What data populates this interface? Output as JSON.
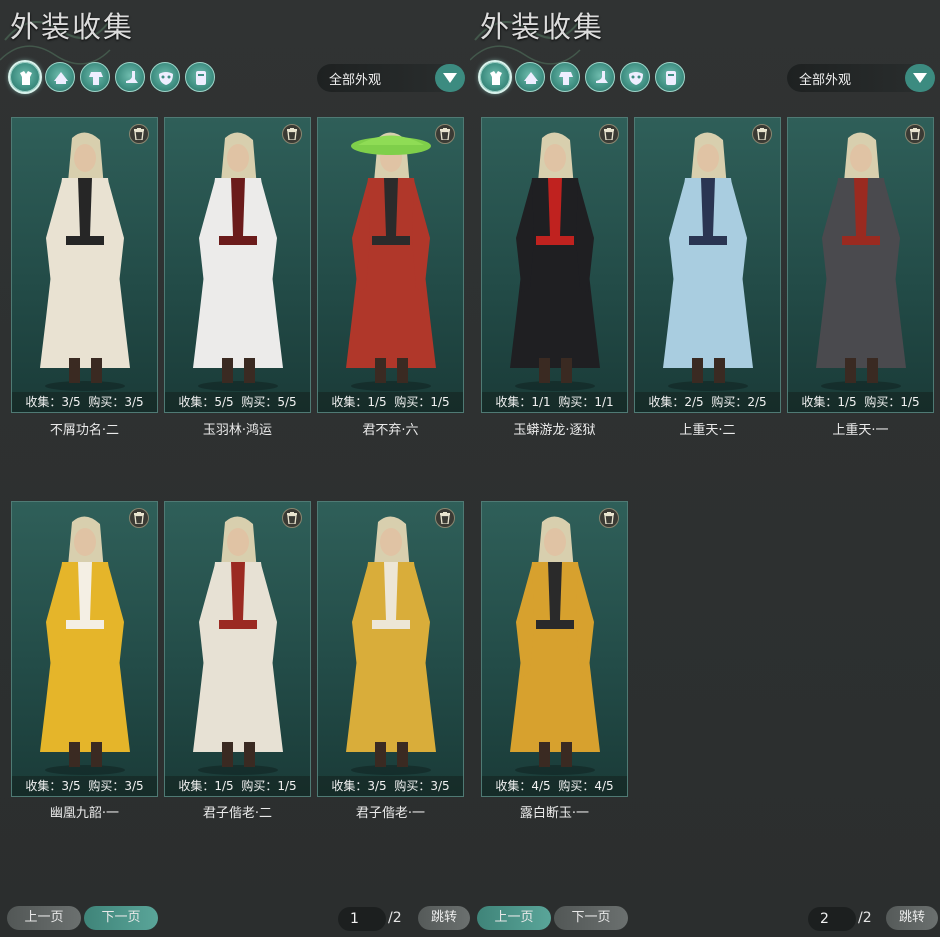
{
  "panels": [
    {
      "title": "外装收集",
      "filter": "全部外观",
      "cards": [
        {
          "name": "不屑功名·二",
          "collect": "收集：3/5",
          "buy": "购买：3/5",
          "outfit": "#e9e2d2",
          "accent": "#262626",
          "hat": false
        },
        {
          "name": "玉羽林·鸿运",
          "collect": "收集：5/5",
          "buy": "购买：5/5",
          "outfit": "#ecebea",
          "accent": "#6b1b1b",
          "hat": false
        },
        {
          "name": "君不弃·六",
          "collect": "收集：1/5",
          "buy": "购买：1/5",
          "outfit": "#b0372a",
          "accent": "#2b2b2b",
          "hat": true
        },
        {
          "name": "幽凰九韶·一",
          "collect": "收集：3/5",
          "buy": "购买：3/5",
          "outfit": "#e5b52a",
          "accent": "#f4efe4",
          "hat": false
        },
        {
          "name": "君子偕老·二",
          "collect": "收集：1/5",
          "buy": "购买：1/5",
          "outfit": "#e7e1d4",
          "accent": "#9b2a22",
          "hat": false
        },
        {
          "name": "君子偕老·一",
          "collect": "收集：3/5",
          "buy": "购买：3/5",
          "outfit": "#d9ad3a",
          "accent": "#ede6d6",
          "hat": false
        }
      ],
      "pager": {
        "prev": "上一页",
        "next": "下一页",
        "page": "1",
        "total": "/2",
        "jump": "跳转"
      }
    },
    {
      "title": "外装收集",
      "filter": "全部外观",
      "cards": [
        {
          "name": "玉蟒游龙·逐狱",
          "collect": "收集：1/1",
          "buy": "购买：1/1",
          "outfit": "#1f1f22",
          "accent": "#c0221f",
          "hat": false
        },
        {
          "name": "上重天·二",
          "collect": "收集：2/5",
          "buy": "购买：2/5",
          "outfit": "#a9cde0",
          "accent": "#2a3552",
          "hat": false
        },
        {
          "name": "上重天·一",
          "collect": "收集：1/5",
          "buy": "购买：1/5",
          "outfit": "#4a4a4e",
          "accent": "#9a2a20",
          "hat": false
        },
        {
          "name": "露白断玉·一",
          "collect": "收集：4/5",
          "buy": "购买：4/5",
          "outfit": "#d7a12e",
          "accent": "#2a2a2a",
          "hat": false
        }
      ],
      "pager": {
        "prev": "上一页",
        "next": "下一页",
        "page": "2",
        "total": "/2",
        "jump": "跳转"
      }
    }
  ],
  "colors": {
    "accent": "#3c8b80",
    "card_bg": "#2a5852",
    "panel_bg": "#2e3131"
  },
  "icons": [
    "outfit-all-icon",
    "headwear-icon",
    "top-icon",
    "shoes-icon",
    "mask-icon",
    "back-icon"
  ]
}
